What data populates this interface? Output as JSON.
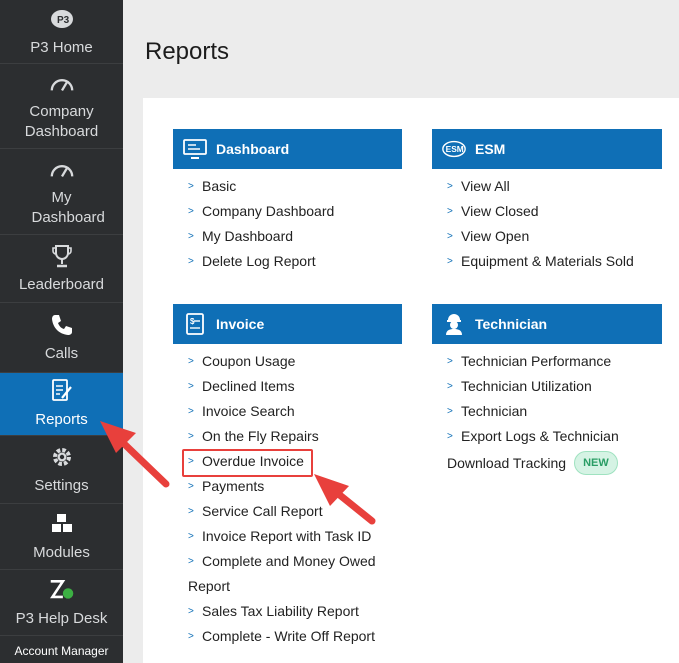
{
  "sidebar": {
    "items": [
      {
        "label": "P3 Home",
        "icon": "p3-logo-icon"
      },
      {
        "label": "Company Dashboard",
        "icon": "gauge-icon"
      },
      {
        "label": "My Dashboard",
        "icon": "gauge-icon"
      },
      {
        "label": "Leaderboard",
        "icon": "trophy-icon"
      },
      {
        "label": "Calls",
        "icon": "phone-icon"
      },
      {
        "label": "Reports",
        "icon": "report-edit-icon"
      },
      {
        "label": "Settings",
        "icon": "gear-icon"
      },
      {
        "label": "Modules",
        "icon": "cubes-icon"
      },
      {
        "label": "P3 Help Desk",
        "icon": "zendesk-icon"
      }
    ],
    "account_label": "Account Manager"
  },
  "page": {
    "title": "Reports"
  },
  "sections": {
    "dashboard": {
      "title": "Dashboard",
      "links": [
        "Basic",
        "Company Dashboard",
        "My Dashboard",
        "Delete Log Report"
      ]
    },
    "esm": {
      "title": "ESM",
      "icon_text": "ESM",
      "links": [
        "View All",
        "View Closed",
        "View Open",
        "Equipment & Materials Sold"
      ]
    },
    "invoice": {
      "title": "Invoice",
      "links": [
        "Coupon Usage",
        "Declined Items",
        "Invoice Search",
        "On the Fly Repairs",
        "Overdue Invoice",
        "Payments",
        "Service Call Report",
        "Invoice Report with Task ID",
        "Complete and Money Owed",
        "Report",
        "Sales Tax Liability Report",
        "Complete - Write Off Report"
      ]
    },
    "technician": {
      "title": "Technician",
      "links": [
        "Technician Performance",
        "Technician Utilization",
        "Technician",
        "Export Logs & Technician",
        "Download Tracking"
      ],
      "badge": "NEW"
    }
  },
  "colors": {
    "accent": "#0f6fb6",
    "sidebar": "#2c2e30",
    "annotation": "#e8403c",
    "badge": "#2a9d65"
  }
}
